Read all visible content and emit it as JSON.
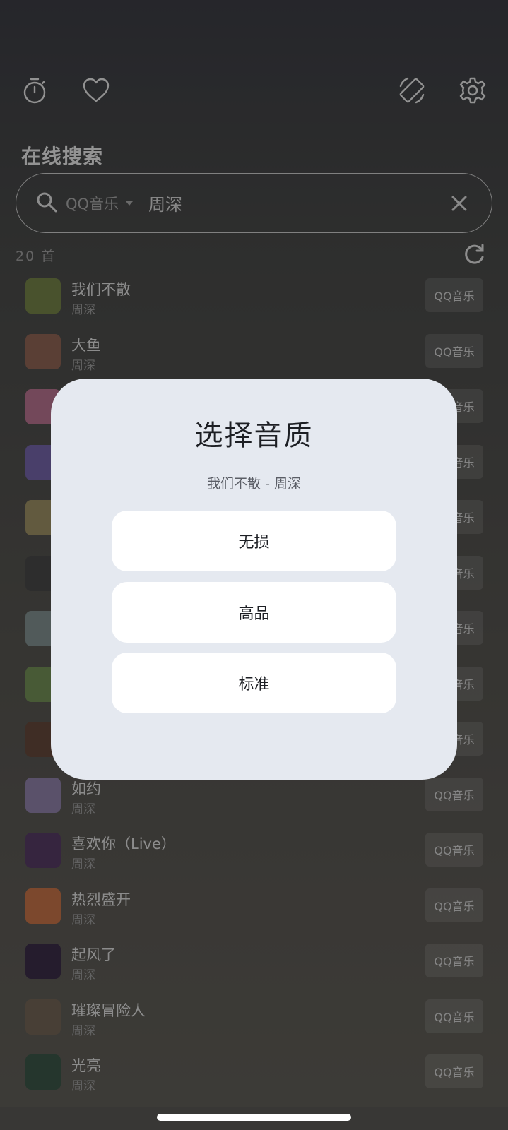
{
  "header": {
    "section_title": "在线搜索"
  },
  "search": {
    "source": "QQ音乐",
    "query": "周深"
  },
  "results": {
    "count_label": "20 首"
  },
  "songs": [
    {
      "title": "我们不散",
      "artist": "周深",
      "source": "QQ音乐",
      "cover": "#6c7d3a"
    },
    {
      "title": "大鱼",
      "artist": "周深",
      "source": "QQ音乐",
      "cover": "#8a5a48"
    },
    {
      "title": "",
      "artist": "",
      "source": "QQ音乐",
      "cover": "#b86a8a"
    },
    {
      "title": "",
      "artist": "",
      "source": "QQ音乐",
      "cover": "#6c5aa8"
    },
    {
      "title": "",
      "artist": "",
      "source": "QQ音乐",
      "cover": "#9a8a5a"
    },
    {
      "title": "",
      "artist": "",
      "source": "QQ音乐",
      "cover": "#3a3a3a"
    },
    {
      "title": "",
      "artist": "",
      "source": "QQ音乐",
      "cover": "#7a8a8a"
    },
    {
      "title": "",
      "artist": "",
      "source": "QQ音乐",
      "cover": "#6a8a4a"
    },
    {
      "title": "",
      "artist": "",
      "source": "QQ音乐",
      "cover": "#5a3a2a"
    },
    {
      "title": "如约",
      "artist": "周深",
      "source": "QQ音乐",
      "cover": "#8a7aa8"
    },
    {
      "title": "喜欢你（Live）",
      "artist": "周深",
      "source": "QQ音乐",
      "cover": "#4a2a5a"
    },
    {
      "title": "热烈盛开",
      "artist": "周深",
      "source": "QQ音乐",
      "cover": "#c86a3a"
    },
    {
      "title": "起风了",
      "artist": "周深",
      "source": "QQ音乐",
      "cover": "#2a1a3a"
    },
    {
      "title": "璀璨冒险人",
      "artist": "周深",
      "source": "QQ音乐",
      "cover": "#6a5a4a"
    },
    {
      "title": "光亮",
      "artist": "周深",
      "source": "QQ音乐",
      "cover": "#2a4a3a"
    }
  ],
  "dialog": {
    "title": "选择音质",
    "subtitle": "我们不散 - 周深",
    "options": [
      "无损",
      "高品",
      "标准"
    ]
  },
  "icons": {
    "timer": "timer-icon",
    "favorite": "heart-icon",
    "rotate": "screen-rotate-icon",
    "settings": "gear-icon",
    "search": "search-icon",
    "clear": "close-icon",
    "refresh": "refresh-icon"
  }
}
